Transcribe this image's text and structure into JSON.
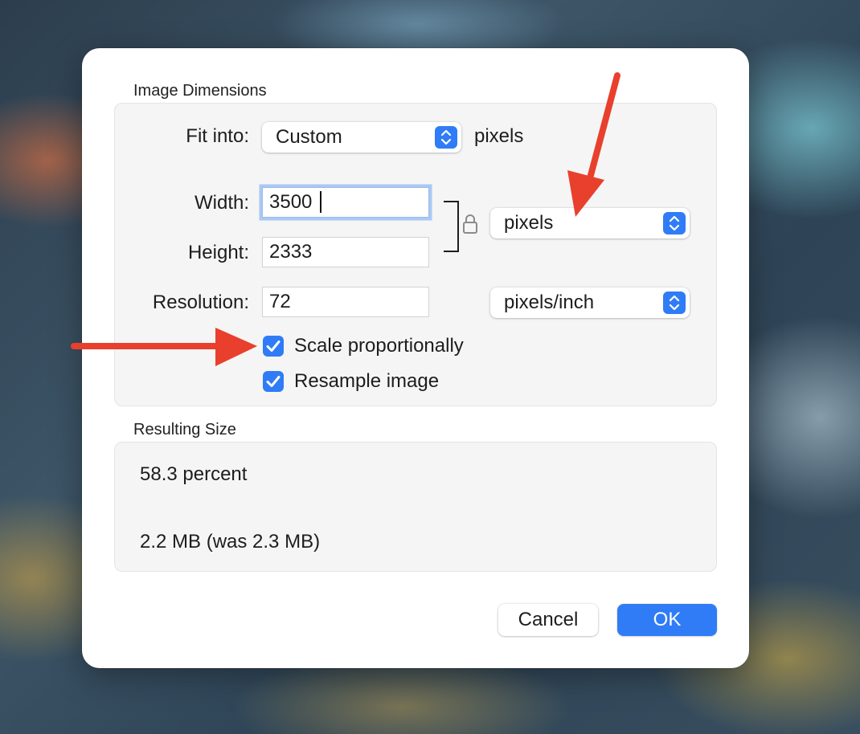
{
  "dialog": {
    "image_dimensions": {
      "title": "Image Dimensions",
      "fit_into_label": "Fit into:",
      "fit_into_value": "Custom",
      "fit_into_unit": "pixels",
      "width_label": "Width:",
      "width_value": "3500",
      "height_label": "Height:",
      "height_value": "2333",
      "size_unit_value": "pixels",
      "resolution_label": "Resolution:",
      "resolution_value": "72",
      "resolution_unit_value": "pixels/inch",
      "scale_proportionally_label": "Scale proportionally",
      "scale_proportionally_checked": true,
      "resample_label": "Resample image",
      "resample_checked": true
    },
    "resulting_size": {
      "title": "Resulting Size",
      "percent": "58.3 percent",
      "file_size": "2.2 MB (was 2.3 MB)"
    },
    "buttons": {
      "cancel": "Cancel",
      "ok": "OK"
    }
  },
  "colors": {
    "accent": "#2f7cf6",
    "annotation_arrow": "#e8402c"
  },
  "icons": [
    "stepper-icon",
    "lock-icon",
    "checkmark-icon",
    "arrow-annotation"
  ]
}
